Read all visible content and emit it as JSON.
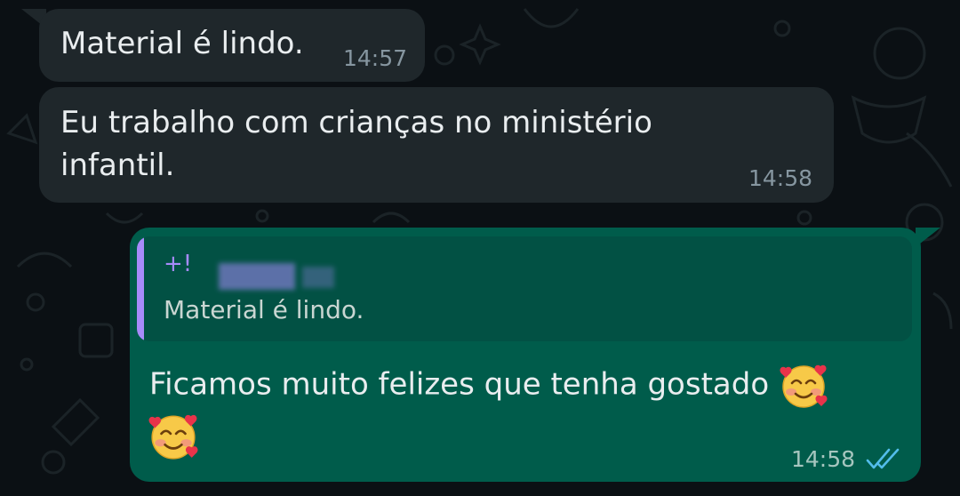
{
  "messages": [
    {
      "id": "m1",
      "direction": "incoming",
      "text": "Material é lindo.",
      "time": "14:57"
    },
    {
      "id": "m2",
      "direction": "incoming",
      "text_lines": [
        "Eu trabalho com crianças no ministério",
        "infantil."
      ],
      "time": "14:58"
    },
    {
      "id": "m3",
      "direction": "outgoing",
      "quoted": {
        "author": "+!",
        "text": "Material é lindo."
      },
      "text": "Ficamos muito felizes que tenha gostado",
      "emoji": "smiling-face-with-hearts",
      "time": "14:58",
      "status": "read"
    }
  ],
  "colors": {
    "background": "#0b1014",
    "incoming_bubble": "#1f272b",
    "outgoing_bubble": "#005c4b",
    "quote_accent": "#a78bfa",
    "read_ticks": "#53bdeb"
  }
}
